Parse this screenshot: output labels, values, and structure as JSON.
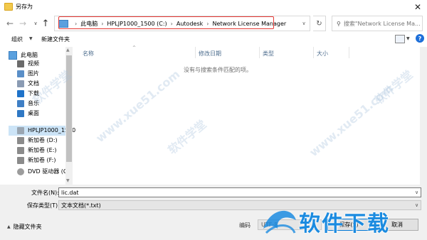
{
  "window": {
    "title": "另存为",
    "close_glyph": "✕"
  },
  "nav": {
    "back_glyph": "←",
    "forward_glyph": "→",
    "history_glyph": "∨",
    "up_glyph": "↑",
    "refresh_glyph": "↻"
  },
  "address": {
    "sep": "›",
    "crumbs": [
      "此电脑",
      "HPLJP1000_1500 (C:)",
      "Autodesk",
      "Network License Manager"
    ],
    "dropdown_glyph": "∨",
    "highlight_color": "#e53935"
  },
  "search": {
    "placeholder": "搜索\"Network License Ma..."
  },
  "toolbar": {
    "organize": "组织",
    "new_folder": "新建文件夹",
    "help": "?"
  },
  "sidebar": {
    "this_pc": "此电脑",
    "items": [
      {
        "label": "视频",
        "icon": "video-folder-icon",
        "color": "#6b6b6b"
      },
      {
        "label": "图片",
        "icon": "pictures-folder-icon",
        "color": "#5a8fc8"
      },
      {
        "label": "文档",
        "icon": "documents-folder-icon",
        "color": "#8a9bb3"
      },
      {
        "label": "下载",
        "icon": "downloads-folder-icon",
        "color": "#1f73c9"
      },
      {
        "label": "音乐",
        "icon": "music-folder-icon",
        "color": "#3f7fc5"
      },
      {
        "label": "桌面",
        "icon": "desktop-folder-icon",
        "color": "#2f78c4"
      },
      {
        "label": "HPLJP1000_1500",
        "icon": "drive-icon",
        "color": "#9aa6b2"
      },
      {
        "label": "新加卷 (D:)",
        "icon": "drive-icon",
        "color": "#8b8b8b"
      },
      {
        "label": "新加卷 (E:)",
        "icon": "drive-icon",
        "color": "#8b8b8b"
      },
      {
        "label": "新加卷 (F:)",
        "icon": "drive-icon",
        "color": "#8b8b8b"
      },
      {
        "label": "DVD 驱动器 (G:",
        "icon": "dvd-drive-icon",
        "color": "#9c9c9c"
      }
    ]
  },
  "columns": {
    "name": "名称",
    "modified": "修改日期",
    "type": "类型",
    "size": "大小"
  },
  "empty_message": "没有与搜索条件匹配的项。",
  "form": {
    "filename_label": "文件名(N):",
    "filename_value": "lic.dat",
    "filetype_label": "保存类型(T):",
    "filetype_value": "文本文档(*.txt)",
    "hide_folders": "隐藏文件夹",
    "encoding_label": "编码",
    "encoding_value": "UTF-8",
    "save": "保存(S)",
    "cancel": "取消"
  },
  "watermark": {
    "text": "软件学堂 www.xue51.com",
    "logo_text": "软件下载"
  }
}
